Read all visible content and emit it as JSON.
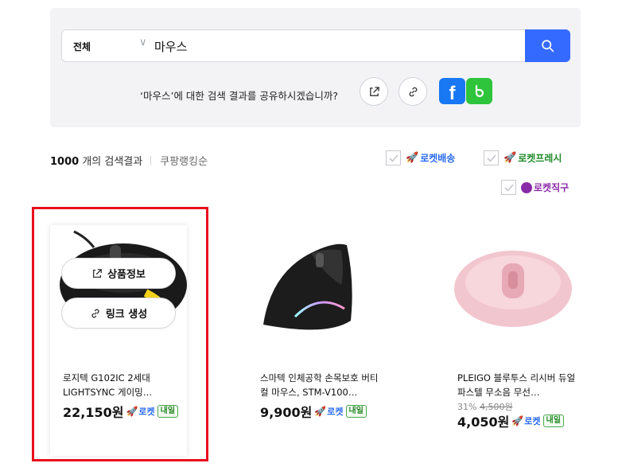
{
  "search": {
    "category": "전체",
    "query": "마우스",
    "share_prompt": "‘마우스’에 대한 검색 결과를 공유하시겠습니까?"
  },
  "results": {
    "count": "1000",
    "count_suffix": "개의 검색결과",
    "sort": "쿠팡랭킹순"
  },
  "filters": [
    {
      "label": "로켓배송",
      "color": "#2a6af0"
    },
    {
      "label": "로켓프레시",
      "color": "#1f8a2a"
    },
    {
      "label": "로켓직구",
      "color": "#8a2aa8"
    }
  ],
  "products": [
    {
      "title": "로지텍 G102IC 2세대 LIGHTSYNC 게이밍…",
      "price": "22,150원",
      "rocket": "로켓",
      "delivery": "내일",
      "overlay": {
        "info_label": "상품정보",
        "link_label": "링크 생성"
      }
    },
    {
      "title": "스마텍 인체공학 손목보호 버티컬 마우스, STM-V100…",
      "price": "9,900원",
      "rocket": "로켓",
      "delivery": "내일"
    },
    {
      "title": "PLEIGO 블루투스 리시버 듀얼 파스텔 무소음 무선…",
      "discount": "31%",
      "original_price": "4,500원",
      "price": "4,050원",
      "rocket": "로켓",
      "delivery": "내일"
    }
  ],
  "colors": {
    "accent": "#346aff",
    "highlight": "#e8101c",
    "facebook": "#1877f2",
    "band": "#2ec43c"
  }
}
